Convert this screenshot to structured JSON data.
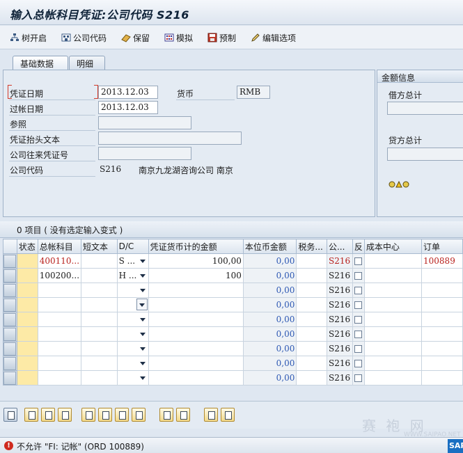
{
  "window": {
    "title": "输入总帐科目凭证:公司代码 S216"
  },
  "toolbar": {
    "tree_open": "树开启",
    "company_code": "公司代码",
    "hold": "保留",
    "simulate": "模拟",
    "park": "预制",
    "edit_options": "编辑选项"
  },
  "tabs": {
    "basic": "基础数据",
    "detail": "明细"
  },
  "basic": {
    "doc_date_label": "凭证日期",
    "doc_date": "2013.12.03",
    "currency_label": "货币",
    "currency": "RMB",
    "posting_date_label": "过帐日期",
    "posting_date": "2013.12.03",
    "reference_label": "参照",
    "header_text_label": "凭证抬头文本",
    "ic_doc_label": "公司往来凭证号",
    "company_code_label": "公司代码",
    "company_code": "S216",
    "company_name": "南京九龙湖咨询公司 南京"
  },
  "amount_info": {
    "title": "金额信息",
    "debit_total_label": "借方总计",
    "credit_total_label": "贷方总计"
  },
  "grid": {
    "caption": "0 项目 ( 没有选定输入变式 )",
    "headers": [
      "状态",
      "总帐科目",
      "短文本",
      "D/C",
      "凭证货币计的金额",
      "本位币金额",
      "税务...",
      "公...",
      "反",
      "成本中心",
      "订单"
    ],
    "rows": [
      {
        "gl": "400110...",
        "dc": "S ...",
        "amount": "100,00",
        "local": "0,00",
        "cc": "S216",
        "order": "100889"
      },
      {
        "gl": "100200...",
        "dc": "H ...",
        "amount": "100",
        "local": "0,00",
        "cc": "S216",
        "order": ""
      },
      {
        "gl": "",
        "dc": "",
        "amount": "",
        "local": "0,00",
        "cc": "S216",
        "order": ""
      },
      {
        "gl": "",
        "dc": "",
        "amount": "",
        "local": "0,00",
        "cc": "S216",
        "order": ""
      },
      {
        "gl": "",
        "dc": "",
        "amount": "",
        "local": "0,00",
        "cc": "S216",
        "order": ""
      },
      {
        "gl": "",
        "dc": "",
        "amount": "",
        "local": "0,00",
        "cc": "S216",
        "order": ""
      },
      {
        "gl": "",
        "dc": "",
        "amount": "",
        "local": "0,00",
        "cc": "S216",
        "order": ""
      },
      {
        "gl": "",
        "dc": "",
        "amount": "",
        "local": "0,00",
        "cc": "S216",
        "order": ""
      },
      {
        "gl": "",
        "dc": "",
        "amount": "",
        "local": "0,00",
        "cc": "S216",
        "order": ""
      }
    ]
  },
  "statusbar": {
    "message": "不允许 \"FI: 记帐\" (ORD 100889)",
    "logo": "SAP"
  },
  "watermark": {
    "main": "赛 袍 网",
    "sub": "WWW.SAIPAO.NET"
  },
  "colors": {
    "error": "#cf2a1f",
    "status_cell": "#fdeaa6",
    "accent": "#1a6fc2"
  }
}
